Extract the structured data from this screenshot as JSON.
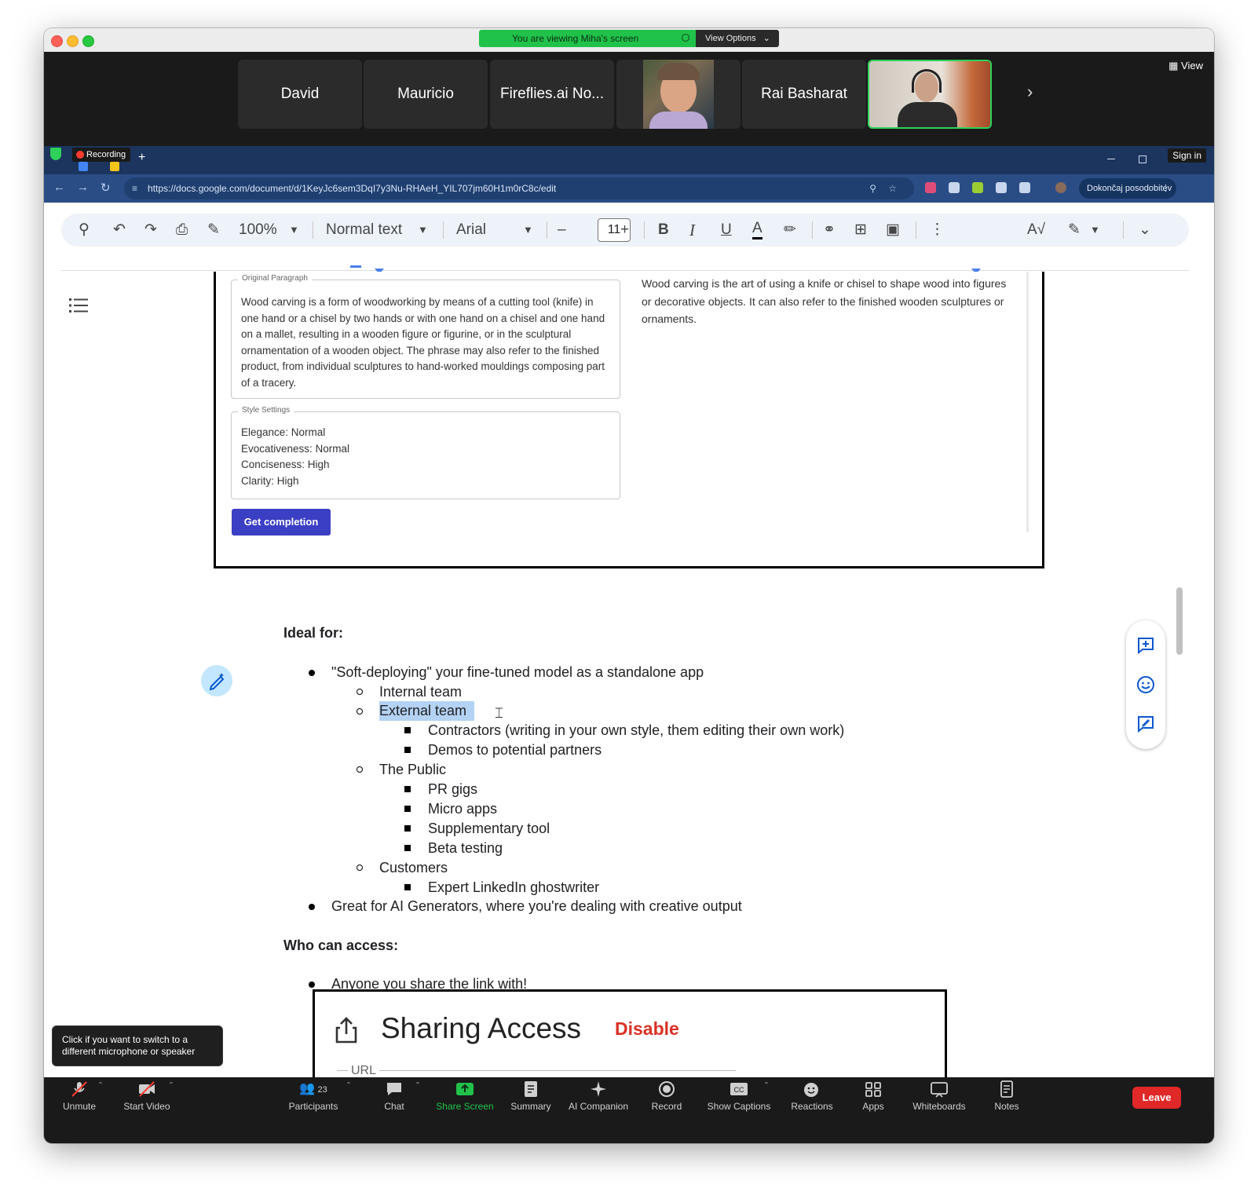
{
  "titlebar": {
    "viewing_text": "You are viewing Miha's screen",
    "view_options": "View Options"
  },
  "participants": {
    "tiles": [
      "David",
      "Mauricio",
      "Fireflies.ai No...",
      "",
      "Rai Basharat",
      ""
    ],
    "view_label": "View"
  },
  "browser": {
    "recording_label": "Recording",
    "sign_in": "Sign in",
    "url": "https://docs.google.com/document/d/1KeyJc6sem3DqI7y3Nu-RHAeH_YIL707jm60H1m0rC8c/edit",
    "profile_button": "Dokončaj posodobitev"
  },
  "toolbar": {
    "zoom": "100%",
    "style": "Normal text",
    "font": "Arial",
    "font_size": "11"
  },
  "embed": {
    "original_legend": "Original Paragraph",
    "original_text": "Wood carving is a form of woodworking by means of a cutting tool (knife) in one hand or a chisel by two hands or with one hand on a chisel and one hand on a mallet, resulting in a wooden figure or figurine, or in the sculptural ornamentation of a wooden object. The phrase may also refer to the finished product, from individual sculptures to hand-worked mouldings composing part of a tracery.",
    "style_legend": "Style Settings",
    "style_lines": [
      "Elegance: Normal",
      "Evocativeness: Normal",
      "Conciseness: High",
      "Clarity: High"
    ],
    "button": "Get completion",
    "output_text": "Wood carving is the art of using a knife or chisel to shape wood into figures or decorative objects. It can also refer to the finished wooden sculptures or ornaments."
  },
  "document": {
    "ideal_heading": "Ideal for:",
    "l1_soft": "\"Soft-deploying\" your fine-tuned model as a standalone app",
    "l2_internal": "Internal team",
    "l2_external": "External team",
    "l3_contractors": "Contractors (writing in your own style, them editing their own work)",
    "l3_demos": "Demos to potential partners",
    "l2_public": "The Public",
    "l3_pr": "PR gigs",
    "l3_micro": "Micro apps",
    "l3_supp": "Supplementary tool",
    "l3_beta": "Beta testing",
    "l2_customers": "Customers",
    "l3_linkedin": "Expert LinkedIn ghostwriter",
    "l1_great": "Great for AI Generators, where you're dealing with creative output",
    "access_heading": "Who can access:",
    "l1_anyone": "Anyone you share the link with!",
    "share_title": "Sharing Access",
    "share_disable": "Disable",
    "share_url_label": "URL"
  },
  "tooltip": "Click if you want to switch to a different microphone or speaker",
  "zoom_controls": {
    "unmute": "Unmute",
    "start_video": "Start Video",
    "participants": "Participants",
    "participant_count": "23",
    "chat": "Chat",
    "share_screen": "Share Screen",
    "summary": "Summary",
    "ai_companion": "AI Companion",
    "record": "Record",
    "captions": "Show Captions",
    "reactions": "Reactions",
    "apps": "Apps",
    "whiteboards": "Whiteboards",
    "notes": "Notes",
    "leave": "Leave"
  },
  "colors": {
    "share_green": "#21c24a",
    "leave_red": "#e02828",
    "docs_button": "#3b3fc4",
    "selection": "#b4d3f4"
  }
}
